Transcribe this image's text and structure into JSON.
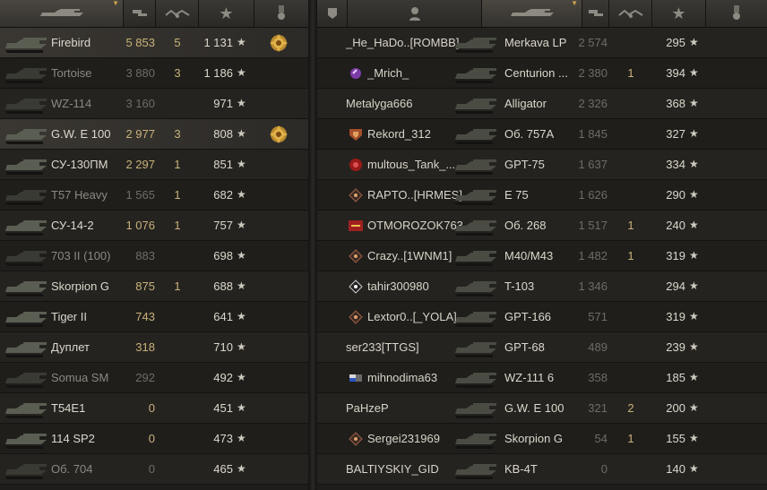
{
  "left_header": {
    "icons": [
      "tank-icon",
      "battles-icon",
      "wins-icon",
      "star-icon",
      "medal-icon"
    ]
  },
  "left_rows": [
    {
      "tank": "Firebird",
      "battles": "5 853",
      "wins": "5",
      "xp": "1 131",
      "medal": true,
      "highlight": true,
      "dim": false
    },
    {
      "tank": "Tortoise",
      "battles": "3 880",
      "wins": "3",
      "xp": "1 186",
      "medal": false,
      "dim": true
    },
    {
      "tank": "WZ-114",
      "battles": "3 160",
      "wins": "",
      "xp": "971",
      "medal": false,
      "dim": true
    },
    {
      "tank": "G.W. E 100",
      "battles": "2 977",
      "wins": "3",
      "xp": "808",
      "medal": true,
      "highlight": true,
      "dim": false
    },
    {
      "tank": "СУ-130ПМ",
      "battles": "2 297",
      "wins": "1",
      "xp": "851",
      "medal": false,
      "dim": false
    },
    {
      "tank": "T57 Heavy",
      "battles": "1 565",
      "wins": "1",
      "xp": "682",
      "medal": false,
      "dim": true
    },
    {
      "tank": "СУ-14-2",
      "battles": "1 076",
      "wins": "1",
      "xp": "757",
      "medal": false,
      "dim": false
    },
    {
      "tank": "703 II (100)",
      "battles": "883",
      "wins": "",
      "xp": "698",
      "medal": false,
      "dim": true
    },
    {
      "tank": "Skorpion G",
      "battles": "875",
      "wins": "1",
      "xp": "688",
      "medal": false,
      "dim": false
    },
    {
      "tank": "Tiger II",
      "battles": "743",
      "wins": "",
      "xp": "641",
      "medal": false,
      "dim": false
    },
    {
      "tank": "Дуплет",
      "battles": "318",
      "wins": "",
      "xp": "710",
      "medal": false,
      "dim": false
    },
    {
      "tank": "Somua SM",
      "battles": "292",
      "wins": "",
      "xp": "492",
      "medal": false,
      "dim": true
    },
    {
      "tank": "T54E1",
      "battles": "0",
      "wins": "",
      "xp": "451",
      "medal": false,
      "dim": false
    },
    {
      "tank": "114 SP2",
      "battles": "0",
      "wins": "",
      "xp": "473",
      "medal": false,
      "dim": false
    },
    {
      "tank": "Об. 704",
      "battles": "0",
      "wins": "",
      "xp": "465",
      "medal": false,
      "dim": true
    }
  ],
  "right_header": {
    "icons": [
      "clan-icon",
      "player-icon",
      "tank-icon",
      "battles-icon",
      "wins-icon",
      "star-icon",
      "medal-icon"
    ]
  },
  "right_rows": [
    {
      "player": "_He_HaDo..[ROMBB]",
      "clan_icon": "none",
      "tank": "Merkava LP",
      "battles": "2 574",
      "wins": "",
      "xp": "295"
    },
    {
      "player": "_Mrich_",
      "clan_icon": "purple",
      "tank": "Centurion ...",
      "battles": "2 380",
      "wins": "1",
      "xp": "394"
    },
    {
      "player": "Metalyga666",
      "clan_icon": "none",
      "tank": "Alligator",
      "battles": "2 326",
      "wins": "",
      "xp": "368"
    },
    {
      "player": "Rekord_312",
      "clan_icon": "shield-red",
      "tank": "Об. 757А",
      "battles": "1 845",
      "wins": "",
      "xp": "327"
    },
    {
      "player": "multous_Tank_...",
      "clan_icon": "red-circle",
      "tank": "GPT-75",
      "battles": "1 637",
      "wins": "",
      "xp": "334"
    },
    {
      "player": "RAPTO..[HRMES]",
      "clan_icon": "diamond",
      "tank": "E 75",
      "battles": "1 626",
      "wins": "",
      "xp": "290"
    },
    {
      "player": "OTMOROZOK763",
      "clan_icon": "red-badge",
      "tank": "Об. 268",
      "battles": "1 517",
      "wins": "1",
      "xp": "240"
    },
    {
      "player": "Crazy..[1WNM1]",
      "clan_icon": "diamond",
      "tank": "M40/M43",
      "battles": "1 482",
      "wins": "1",
      "xp": "319"
    },
    {
      "player": "tahir300980",
      "clan_icon": "diamond-white",
      "tank": "T-103",
      "battles": "1 346",
      "wins": "",
      "xp": "294"
    },
    {
      "player": "Lextor0..[_YOLA]",
      "clan_icon": "diamond",
      "tank": "GPT-166",
      "battles": "571",
      "wins": "",
      "xp": "319"
    },
    {
      "player": "ser233[TTGS]",
      "clan_icon": "none",
      "tank": "GPT-68",
      "battles": "489",
      "wins": "",
      "xp": "239"
    },
    {
      "player": "mihnodima63",
      "clan_icon": "flag",
      "tank": "WZ-111 6",
      "battles": "358",
      "wins": "",
      "xp": "185"
    },
    {
      "player": "PaHzeP",
      "clan_icon": "none",
      "tank": "G.W. E 100",
      "battles": "321",
      "wins": "2",
      "xp": "200"
    },
    {
      "player": "Sergei231969",
      "clan_icon": "diamond",
      "tank": "Skorpion G",
      "battles": "54",
      "wins": "1",
      "xp": "155"
    },
    {
      "player": "BALTIYSKIY_GID",
      "clan_icon": "none",
      "tank": "KB-4T",
      "battles": "0",
      "wins": "",
      "xp": "140"
    }
  ],
  "star_glyph": "★",
  "colors": {
    "gold": "#c9b27a",
    "text": "#dcd8cc",
    "dim": "#8c8980",
    "bg": "#1e1d1b"
  }
}
